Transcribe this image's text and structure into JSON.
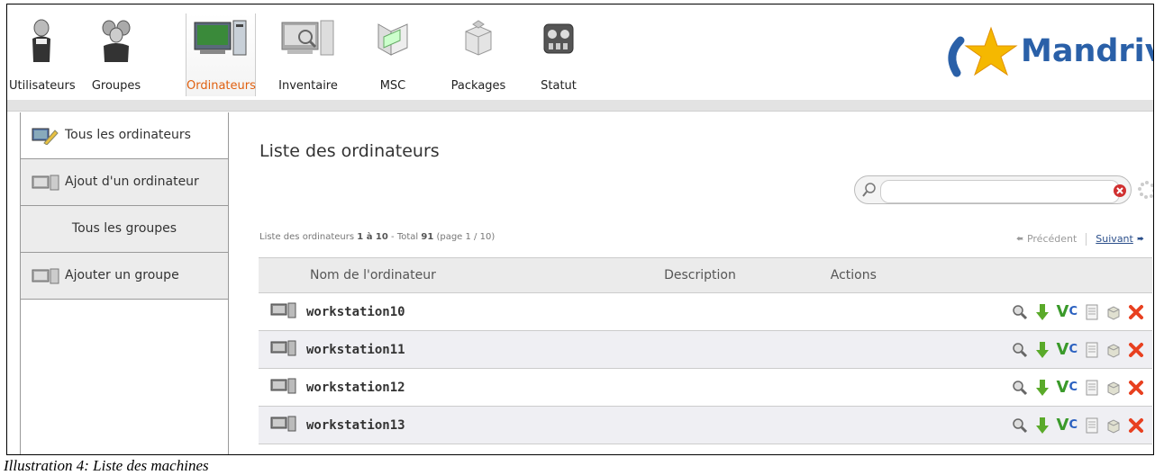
{
  "nav": {
    "items": [
      {
        "label": "Utilisateurs",
        "icon": "user-icon"
      },
      {
        "label": "Groupes",
        "icon": "group-icon"
      },
      {
        "label": "Ordinateurs",
        "icon": "computer-icon",
        "active": true
      },
      {
        "label": "Inventaire",
        "icon": "inventory-icon"
      },
      {
        "label": "MSC",
        "icon": "msc-icon"
      },
      {
        "label": "Packages",
        "icon": "package-icon"
      },
      {
        "label": "Statut",
        "icon": "status-icon"
      }
    ],
    "logo_text": "Mandriv"
  },
  "sidebar": {
    "items": [
      {
        "label": "Tous les ordinateurs",
        "icon": "computers-edit-icon"
      },
      {
        "label": "Ajout d'un ordinateur",
        "icon": "computer-add-icon"
      },
      {
        "label": "Tous les groupes"
      },
      {
        "label": "Ajouter un groupe",
        "icon": "group-add-icon"
      }
    ]
  },
  "main": {
    "title": "Liste des ordinateurs",
    "search": {
      "value": "",
      "placeholder": ""
    },
    "pager": {
      "prefix": "Liste des ordinateurs ",
      "range": "1 à 10",
      "mid": " - Total ",
      "total": "91",
      "page": " (page 1 / 10)",
      "prev": "Précédent",
      "next": "Suivant"
    },
    "table": {
      "headers": {
        "name": "Nom de l'ordinateur",
        "description": "Description",
        "actions": "Actions"
      },
      "rows": [
        {
          "name": "workstation10",
          "description": ""
        },
        {
          "name": "workstation11",
          "description": ""
        },
        {
          "name": "workstation12",
          "description": ""
        },
        {
          "name": "workstation13",
          "description": ""
        }
      ],
      "action_icons": [
        "zoom-icon",
        "download-arrow-icon",
        "vnc-icon",
        "log-document-icon",
        "package-icon",
        "delete-icon"
      ],
      "vnc_label": "V",
      "vnc_sup": "C"
    }
  },
  "caption": "Illustration 4: Liste des machines",
  "colors": {
    "accent": "#e06010",
    "link": "#2a4e8a",
    "logo": "#2a60a8",
    "row_alt": "#efeff3"
  }
}
